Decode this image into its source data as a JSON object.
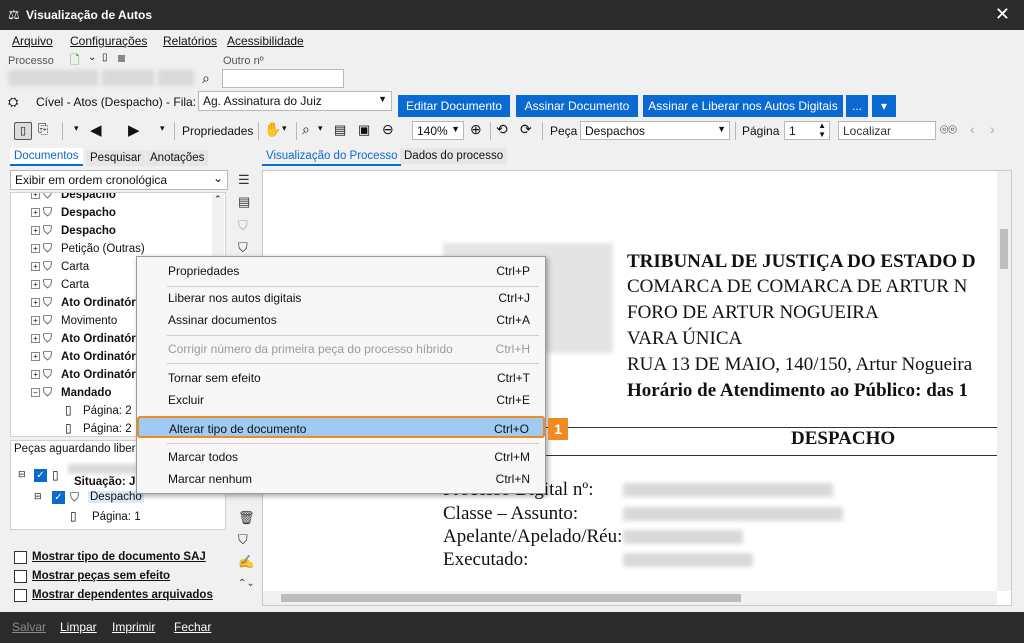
{
  "window": {
    "title": "Visualização de Autos",
    "close_icon": "close-icon"
  },
  "menu": [
    "Arquivo",
    "Configurações",
    "Relatórios",
    "Acessibilidade"
  ],
  "process": {
    "processo_label": "Processo",
    "outro_label": "Outro nº"
  },
  "filter_line": {
    "text": "Cível - Atos (Despacho) - Fila:",
    "fila_value": "Ag. Assinatura do Juiz"
  },
  "buttons": {
    "editar": "Editar Documento",
    "assinar": "Assinar Documento",
    "assinar_liberar": "Assinar e Liberar nos Autos Digitais",
    "more": "...",
    "dropdown": "▾"
  },
  "toolbar": {
    "propriedades": "Propriedades",
    "zoom": "140%",
    "peca_label": "Peça",
    "peca_value": "Despachos",
    "pagina_label": "Página",
    "pagina_value": "1",
    "localizar_placeholder": "Localizar"
  },
  "left_tabs": [
    "Documentos",
    "Pesquisar",
    "Anotações"
  ],
  "order_select": "Exibir em ordem cronológica",
  "tree": [
    {
      "label": "Despacho",
      "bold": true
    },
    {
      "label": "Despacho",
      "bold": true
    },
    {
      "label": "Despacho",
      "bold": true
    },
    {
      "label": "Petição (Outras)",
      "bold": false
    },
    {
      "label": "Carta",
      "bold": false
    },
    {
      "label": "Carta",
      "bold": false
    },
    {
      "label": "Ato Ordinatório",
      "bold": true
    },
    {
      "label": "Movimento",
      "bold": false
    },
    {
      "label": "Ato Ordinatório",
      "bold": true
    },
    {
      "label": "Ato Ordinatório",
      "bold": true
    },
    {
      "label": "Ato Ordinatório",
      "bold": true
    },
    {
      "label": "Mandado",
      "bold": true
    },
    {
      "label": "Página: 2",
      "bold": false
    },
    {
      "label": "Página: 2",
      "bold": false
    }
  ],
  "pending": {
    "title": "Peças aguardando liberação",
    "situacao": "Situação: Ju",
    "despacho": "Despacho",
    "pagina": "Página: 1"
  },
  "options": [
    "Mostrar tipo de documento SAJ",
    "Mostrar peças sem efeito",
    "Mostrar dependentes arquivados"
  ],
  "doc_tabs": [
    "Visualização do Processo",
    "Dados do processo"
  ],
  "document": {
    "header_lines": [
      "TRIBUNAL DE JUSTIÇA DO ESTADO D",
      "COMARCA DE COMARCA DE ARTUR N",
      "FORO DE ARTUR NOGUEIRA",
      "VARA ÚNICA",
      "RUA 13 DE MAIO, 140/150, Artur Nogueira",
      "Horário de Atendimento ao Público: das 1"
    ],
    "section_title": "DESPACHO",
    "fields": [
      "Processo Digital nº:",
      "Classe – Assunto:",
      "Apelante/Apelado/Réu:",
      "Executado:"
    ]
  },
  "context_menu": [
    {
      "label": "Propriedades",
      "shortcut": "Ctrl+P",
      "disabled": false
    },
    {
      "label": "Liberar nos autos digitais",
      "shortcut": "Ctrl+J",
      "disabled": false
    },
    {
      "label": "Assinar documentos",
      "shortcut": "Ctrl+A",
      "disabled": false
    },
    {
      "label": "Corrigir número da primeira peça do processo híbrido",
      "shortcut": "Ctrl+H",
      "disabled": true
    },
    {
      "label": "Tornar sem efeito",
      "shortcut": "Ctrl+T",
      "disabled": false
    },
    {
      "label": "Excluir",
      "shortcut": "Ctrl+E",
      "disabled": false
    },
    {
      "label": "Alterar tipo de documento",
      "shortcut": "Ctrl+O",
      "disabled": false
    },
    {
      "label": "Marcar todos",
      "shortcut": "Ctrl+M",
      "disabled": false
    },
    {
      "label": "Marcar nenhum",
      "shortcut": "Ctrl+N",
      "disabled": false
    }
  ],
  "step_badge": "1",
  "bottom_actions": [
    {
      "label": "Salvar",
      "disabled": true
    },
    {
      "label": "Limpar",
      "disabled": false
    },
    {
      "label": "Imprimir",
      "disabled": false
    },
    {
      "label": "Fechar",
      "disabled": false
    }
  ],
  "colors": {
    "accent": "#0a6ad2",
    "highlight_border": "#f08a24",
    "highlight_fill": "#9fcbf3",
    "titlebar": "#2b2b2b"
  }
}
